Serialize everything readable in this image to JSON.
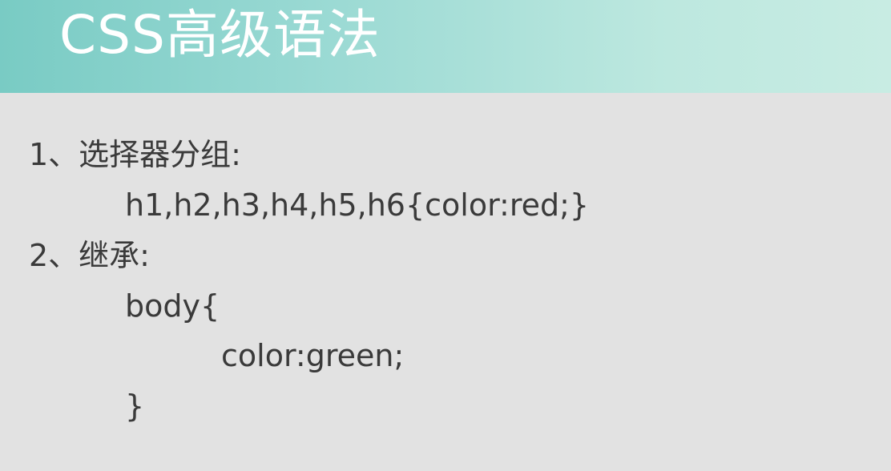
{
  "slide": {
    "title": "CSS高级语法",
    "lines": [
      "1、选择器分组:",
      "h1,h2,h3,h4,h5,h6{color:red;}",
      "2、继承:",
      "body{",
      "color:green;",
      "}"
    ]
  },
  "colors": {
    "header_start": "#79cbc4",
    "header_end": "#c8ece3",
    "background": "#e2e2e2",
    "text": "#3a3a3a",
    "title_text": "#ffffff"
  }
}
